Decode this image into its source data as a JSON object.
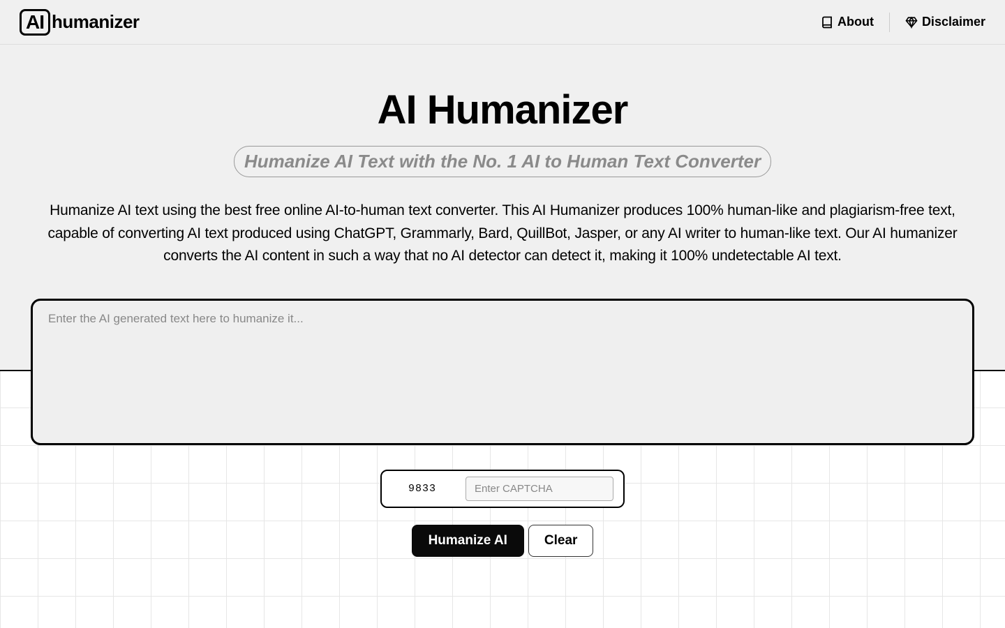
{
  "header": {
    "logo_box": "AI",
    "logo_text": "humanizer",
    "nav": {
      "about": "About",
      "disclaimer": "Disclaimer"
    }
  },
  "hero": {
    "title": "AI Humanizer",
    "subtitle": "Humanize AI Text with the No. 1 AI to Human Text Converter",
    "description": "Humanize AI text using the best free online AI-to-human text converter. This AI Humanizer produces 100% human-like and plagiarism-free text, capable of converting AI text produced using ChatGPT, Grammarly, Bard, QuillBot, Jasper, or any AI writer to human-like text. Our AI humanizer converts the AI content in such a way that no AI detector can detect it, making it 100% undetectable AI text."
  },
  "form": {
    "textarea_placeholder": "Enter the AI generated text here to humanize it...",
    "textarea_value": "",
    "captcha_code": "9833",
    "captcha_placeholder": "Enter CAPTCHA",
    "captcha_value": "",
    "submit_label": "Humanize AI",
    "clear_label": "Clear"
  }
}
